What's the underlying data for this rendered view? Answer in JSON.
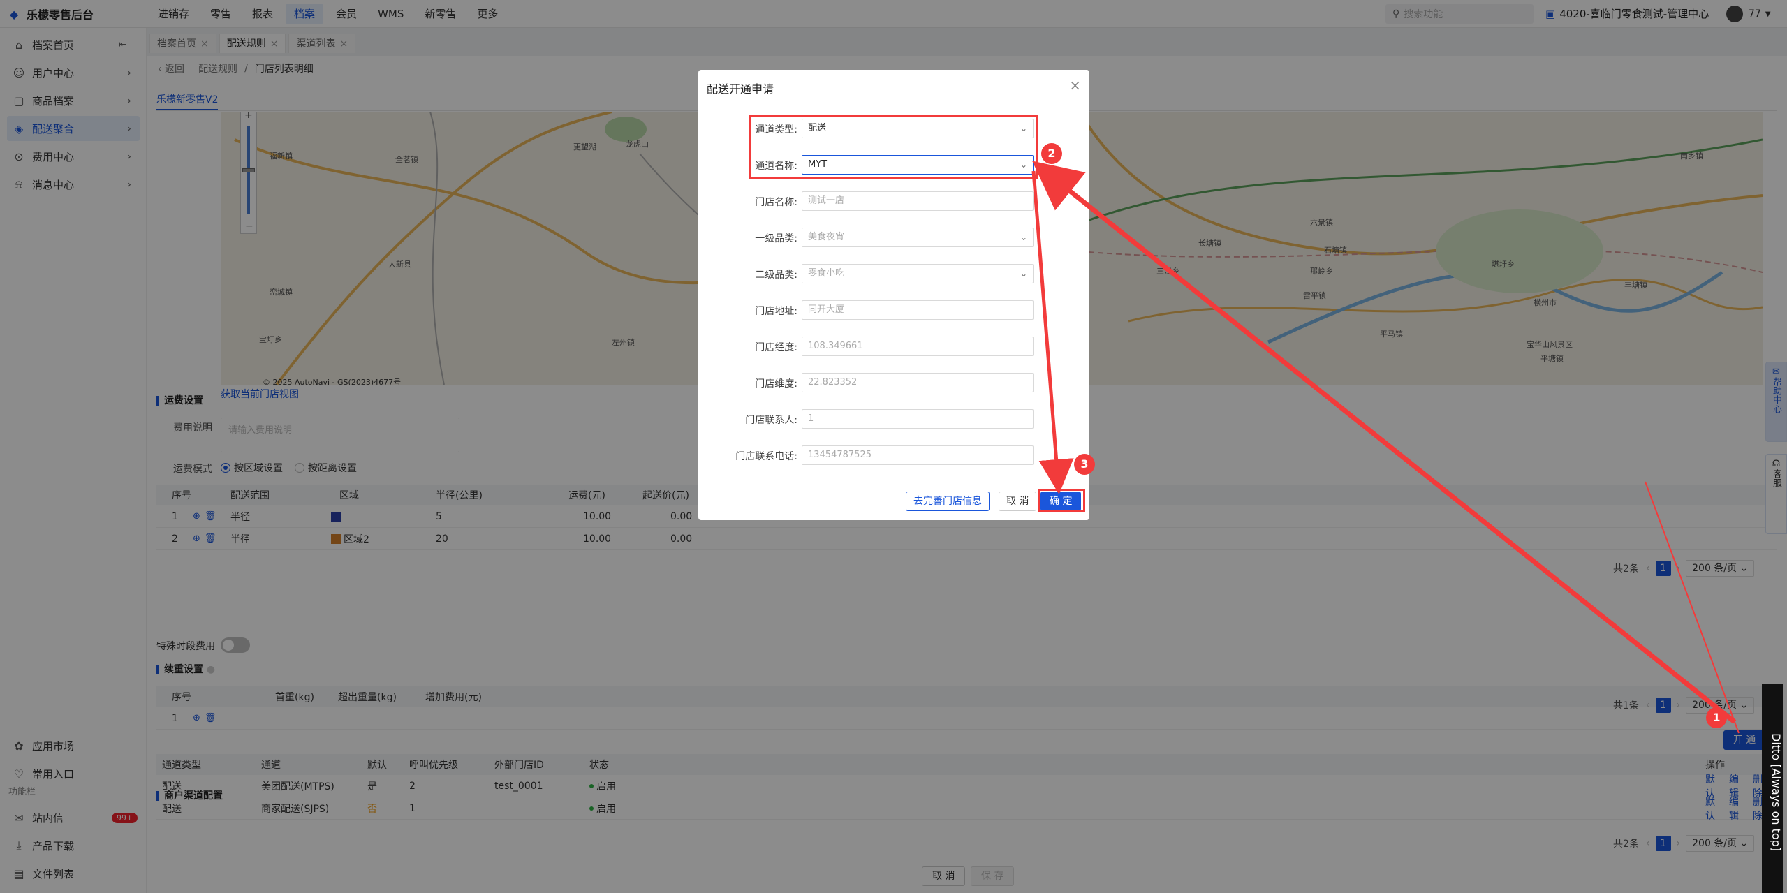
{
  "app": {
    "logo": "乐檬零售后台"
  },
  "topnav": [
    "进销存",
    "零售",
    "报表",
    "档案",
    "会员",
    "WMS",
    "新零售",
    "更多"
  ],
  "topnav_active": 3,
  "search": {
    "placeholder": "搜索功能"
  },
  "store": "4020-喜临门零食测试-管理中心",
  "user": "77",
  "sidebar": {
    "items": [
      "档案首页",
      "用户中心",
      "商品档案",
      "配送聚合",
      "费用中心",
      "消息中心"
    ],
    "active": 3,
    "bottom": [
      "应用市场",
      "常用入口"
    ],
    "group_label": "功能栏",
    "func": [
      "站内信",
      "产品下载",
      "文件列表"
    ],
    "badge": "99+"
  },
  "tabs": [
    "档案首页",
    "配送规则",
    "渠道列表"
  ],
  "tab_active": 1,
  "breadcrumb": {
    "back": "返回",
    "parent": "配送规则",
    "current": "门店列表明细"
  },
  "subtab": "乐檬新零售V2",
  "map": {
    "link": "获取当前门店视图",
    "copyright": "© 2025 AutoNavi - GS(2023)4677号",
    "labels": [
      "大新县",
      "更望湖",
      "龙虎山",
      "左州镇",
      "宝圩乡",
      "福新镇",
      "全茗镇",
      "雷平镇",
      "堪圩乡",
      "那岭乡",
      "六景镇",
      "横州市",
      "长塘镇",
      "石塘镇",
      "平马镇",
      "峦城镇",
      "宝华山风景区",
      "平塘镇",
      "三江乡",
      "丰塘镇",
      "南乡镇"
    ]
  },
  "fee": {
    "section": "运费设置",
    "desc_label": "费用说明",
    "desc_placeholder": "请输入费用说明",
    "mode_label": "运费模式",
    "mode_options": [
      "按区域设置",
      "按距离设置"
    ],
    "mode_selected": 0,
    "columns": [
      "序号",
      "配送范围",
      "区域",
      "半径(公里)",
      "运费(元)",
      "起送价(元)"
    ],
    "rows": [
      {
        "no": "1",
        "range": "半径",
        "area": "",
        "area_color": "#2a3ea8",
        "radius": "5",
        "fee": "10.00",
        "min": "0.00"
      },
      {
        "no": "2",
        "range": "半径",
        "area": "区域2",
        "area_color": "#d4802a",
        "radius": "20",
        "fee": "10.00",
        "min": "0.00"
      }
    ],
    "pager": {
      "total": "共2条",
      "page": "1",
      "size": "200 条/页"
    }
  },
  "special": {
    "label": "特殊时段费用",
    "on": false
  },
  "weight": {
    "section": "续重设置",
    "columns": [
      "序号",
      "首重(kg)",
      "超出重量(kg)",
      "增加费用(元)"
    ],
    "rows": [
      {
        "no": "1"
      }
    ],
    "pager": {
      "total": "共1条",
      "page": "1",
      "size": "200 条/页"
    }
  },
  "channel": {
    "section": "商户渠道配置",
    "open_button": "开 通",
    "columns": [
      "通道类型",
      "通道",
      "默认",
      "呼叫优先级",
      "外部门店ID",
      "状态",
      "操作"
    ],
    "rows": [
      {
        "type": "配送",
        "name": "美团配送(MTPS)",
        "default": "是",
        "priority": "2",
        "ext_id": "test_0001",
        "status": "启用",
        "ops": [
          "默认",
          "编辑",
          "删除"
        ]
      },
      {
        "type": "配送",
        "name": "商家配送(SJPS)",
        "default": "否",
        "priority": "1",
        "ext_id": "",
        "status": "启用",
        "ops": [
          "默认",
          "编辑",
          "删除"
        ]
      }
    ],
    "pager": {
      "total": "共2条",
      "page": "1",
      "size": "200 条/页"
    }
  },
  "footer": {
    "cancel": "取 消",
    "save": "保 存"
  },
  "modal": {
    "title": "配送开通申请",
    "fields": [
      {
        "label": "通道类型:",
        "value": "配送",
        "select": true,
        "active": true
      },
      {
        "label": "通道名称:",
        "value": "MYT",
        "select": true,
        "active": true
      },
      {
        "label": "门店名称:",
        "value": "测试一店",
        "select": false,
        "active": false
      },
      {
        "label": "一级品类:",
        "value": "美食夜宵",
        "select": true,
        "active": false
      },
      {
        "label": "二级品类:",
        "value": "零食小吃",
        "select": true,
        "active": false
      },
      {
        "label": "门店地址:",
        "value": "同开大厦",
        "select": false,
        "active": false
      },
      {
        "label": "门店经度:",
        "value": "108.349661",
        "select": false,
        "active": false
      },
      {
        "label": "门店维度:",
        "value": "22.823352",
        "select": false,
        "active": false
      },
      {
        "label": "门店联系人:",
        "value": "1",
        "select": false,
        "active": false
      },
      {
        "label": "门店联系电话:",
        "value": "13454787525",
        "select": false,
        "active": false
      }
    ],
    "btn_improve": "去完善门店信息",
    "btn_cancel": "取 消",
    "btn_ok": "确 定"
  },
  "steps": [
    "1",
    "2",
    "3"
  ],
  "right_tabs": [
    "帮助中心",
    "客服"
  ],
  "ditto": "Ditto [Always on top]",
  "colors": {
    "primary": "#1a56db",
    "annotation": "#f23b3b"
  }
}
